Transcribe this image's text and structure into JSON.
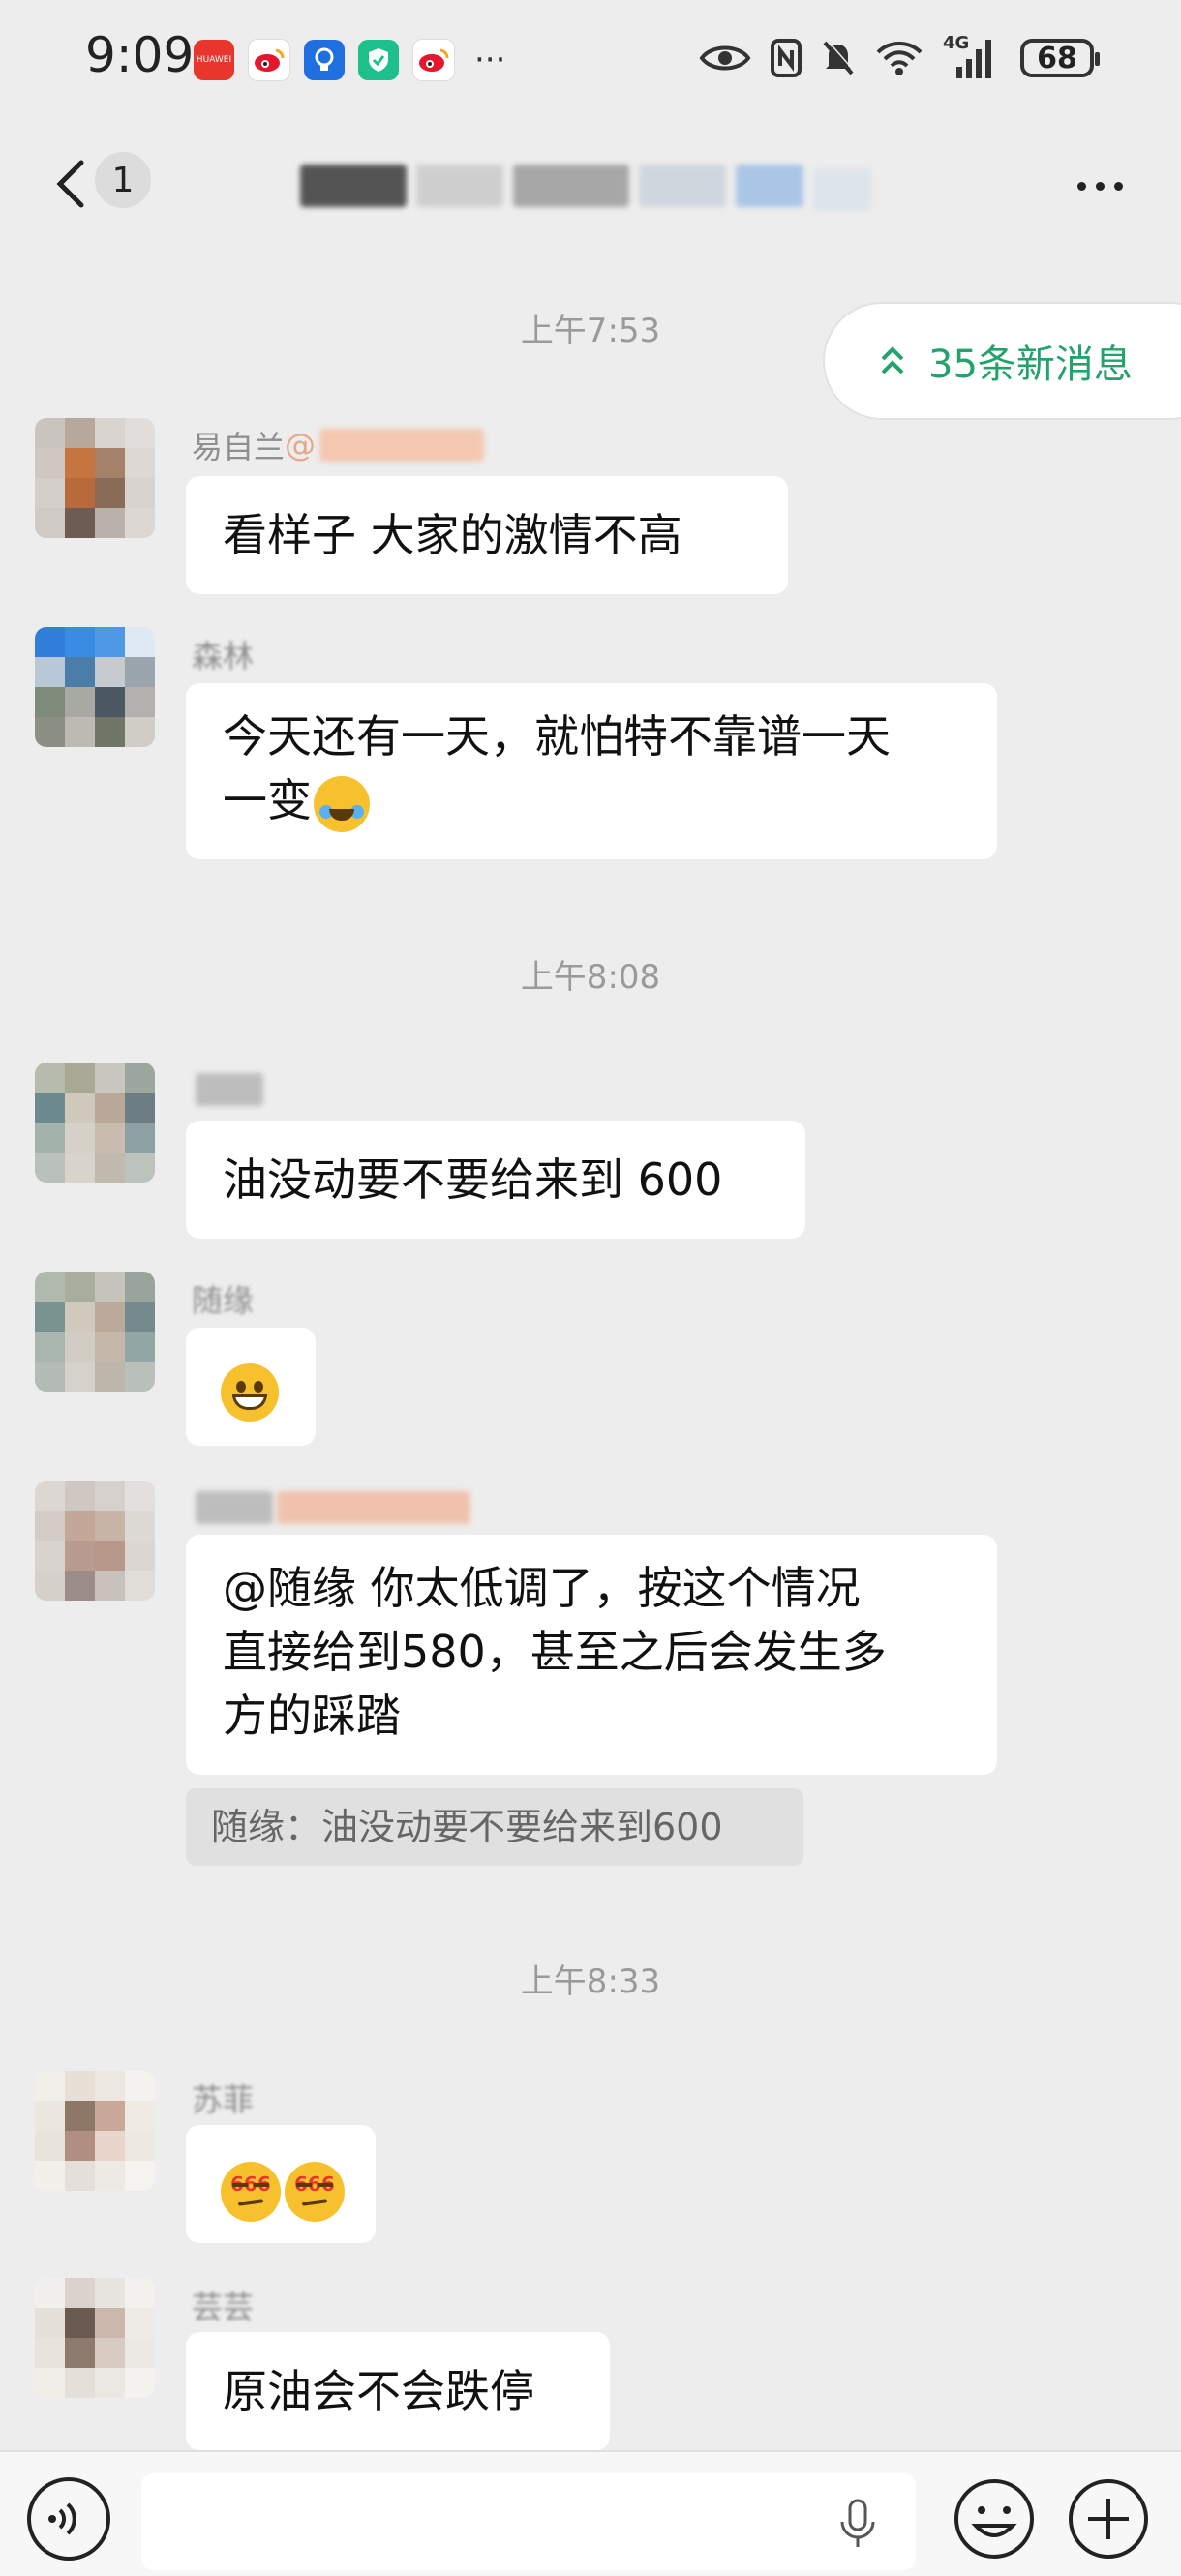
{
  "status_bar": {
    "time": "9:09",
    "app_icons": [
      "huawei-store-icon",
      "weibo-icon",
      "bulb-icon",
      "shield-icon",
      "weibo-icon"
    ],
    "more": "···",
    "signal": "4G",
    "battery": "68"
  },
  "header": {
    "back_icon": "chevron-left-icon",
    "unread_count": "1",
    "title": "",
    "more_icon": "ellipsis-icon"
  },
  "new_messages": {
    "label": "35条新消息",
    "icon": "double-chevron-up-icon",
    "color": "#23a36b"
  },
  "chat": {
    "timestamps": [
      "上午7:53",
      "上午8:08",
      "上午8:33"
    ],
    "messages": [
      {
        "sender": "易自兰",
        "sender_suffix": "@",
        "text": "看样子  大家的激情不高"
      },
      {
        "sender": "森林",
        "text_line1": "今天还有一天，就怕特不靠谱一天",
        "text_line2": "一变"
      },
      {
        "sender": "",
        "text": "油没动要不要给来到 600"
      },
      {
        "sender": "随缘",
        "emoji": "grinning-face"
      },
      {
        "sender": "",
        "text_line1": "@随缘 你太低调了，按这个情况",
        "text_line2": "直接给到580，甚至之后会发生多",
        "text_line3": "方的踩踏",
        "quote": "随缘：油没动要不要给来到600"
      },
      {
        "sender": "苏菲",
        "emoji": "666-face x2",
        "tag": "666"
      },
      {
        "sender": "芸芸",
        "text": "原油会不会跌停"
      }
    ]
  },
  "input_bar": {
    "voice_icon": "voice-icon",
    "mic_icon": "microphone-icon",
    "emoji_icon": "emoji-icon",
    "plus_icon": "plus-icon"
  }
}
